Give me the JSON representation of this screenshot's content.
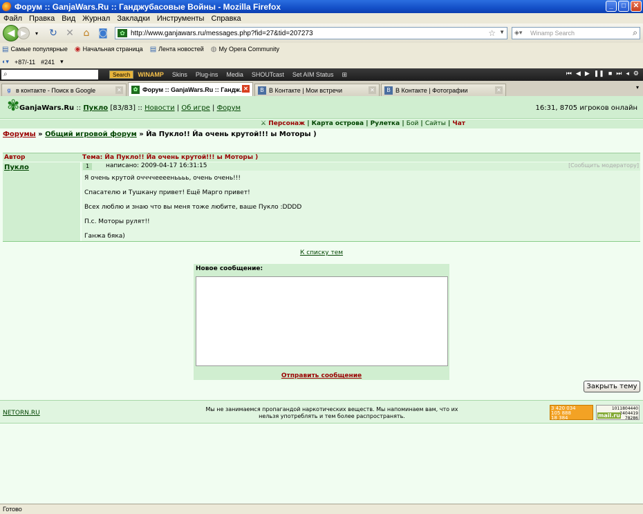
{
  "window": {
    "title": "Форум :: GanjaWars.Ru :: Ганджубасовые Войны - Mozilla Firefox"
  },
  "menu": [
    "Файл",
    "Правка",
    "Вид",
    "Журнал",
    "Закладки",
    "Инструменты",
    "Справка"
  ],
  "nav": {
    "url": "http://www.ganjawars.ru/messages.php?fid=27&tid=207273",
    "search_placeholder": "Winamp Search"
  },
  "bookmarks": [
    "Самые популярные",
    "Начальная страница",
    "Лента новостей",
    "My Opera Community"
  ],
  "opera": {
    "counter": "+87/-11",
    "tab_num": "#241"
  },
  "winamp": {
    "search_btn": "Search",
    "logo": "WINAMP",
    "items": [
      "Skins",
      "Plug-ins",
      "Media",
      "SHOUTcast",
      "Set AIM Status"
    ]
  },
  "tabs": [
    {
      "label": "в контакте - Поиск в Google"
    },
    {
      "label": "Форум :: GanjaWars.Ru :: Гандж..."
    },
    {
      "label": "В Контакте | Мои встречи"
    },
    {
      "label": "В Контакте | Фотографии"
    }
  ],
  "header": {
    "brand": "GanjaWars.Ru",
    "sep": "::",
    "user": "Пукло",
    "hp": "[83/83]",
    "news": "Новости",
    "about": "Об игре",
    "forum": "Форум",
    "online": "16:31, 8705 игроков онлайн"
  },
  "game_menu": [
    "Персонаж",
    "Карта острова",
    "Рулетка",
    "Бой",
    "Сайты",
    "Чат"
  ],
  "breadcrumb": {
    "forums": "Форумы",
    "general": "Общий игровой форум",
    "topic": "Йа Пукло!! Йа очень крутой!!! ы Моторы )"
  },
  "thread": {
    "author_col": "Автор",
    "topic_col": "Тема: Йа Пукло!! Йа очень крутой!!! ы Моторы )",
    "post": {
      "author": "Пукло",
      "num": "1",
      "date": "написано: 2009-04-17 16:31:15",
      "report": "[Сообщить модератору]",
      "lines": [
        "Я очень крутой оччччееееньььь, очень очень!!!",
        "Спасателю и Тушкану привет! Ещё Марго привет!",
        "Всех люблю и знаю что вы меня тоже любите, ваше Пукло :DDDD",
        "П.с. Моторы рулят!!",
        "Ганжа бяка)"
      ]
    }
  },
  "to_list": "К списку тем",
  "new_message": {
    "label": "Новое сообщение:",
    "send": "Отправить сообщение"
  },
  "close_topic": "Закрыть тему",
  "footer": {
    "link": "NETORN.RU",
    "disclaimer_1": "Мы не занимаемся пропагандой наркотических веществ. Мы напоминаем вам, что их",
    "disclaimer_2": "нельзя употреблять и тем более распространять.",
    "counter1": [
      "3 420 034",
      "105 888",
      "18 384"
    ],
    "counter2": {
      "top": "1011804440",
      "mid": "2404419",
      "bot": "78286",
      "brand": "mail.ru"
    }
  },
  "status": "Готово"
}
